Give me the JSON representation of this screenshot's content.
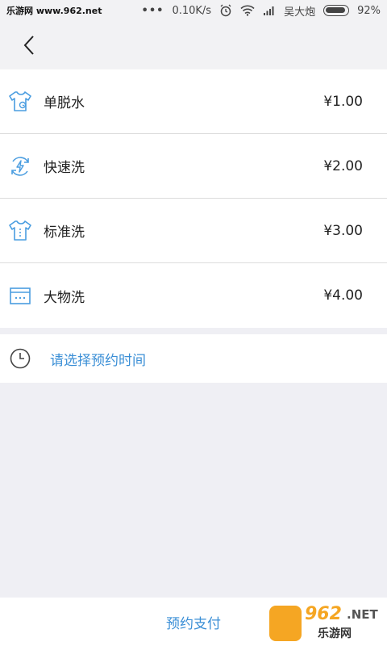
{
  "status_bar": {
    "site": "乐游网 www.962.net",
    "dots": "•••",
    "speed": "0.10K/s",
    "carrier": "吴大炮",
    "battery": "92%"
  },
  "services": [
    {
      "name": "单脱水",
      "price": "¥1.00",
      "icon": "tshirt-spin-icon"
    },
    {
      "name": "快速洗",
      "price": "¥2.00",
      "icon": "lightning-cycle-icon"
    },
    {
      "name": "标准洗",
      "price": "¥3.00",
      "icon": "shirt-icon"
    },
    {
      "name": "大物洗",
      "price": "¥4.00",
      "icon": "box-icon"
    }
  ],
  "schedule": {
    "label": "请选择预约时间",
    "icon": "clock-icon"
  },
  "footer": {
    "pay_label": "预约支付"
  },
  "watermark": {
    "num": "962",
    "net": ".NET",
    "cn": "乐游网"
  },
  "colors": {
    "accent": "#3b8fd6",
    "icon": "#4a9de0",
    "background": "#efeff4"
  }
}
